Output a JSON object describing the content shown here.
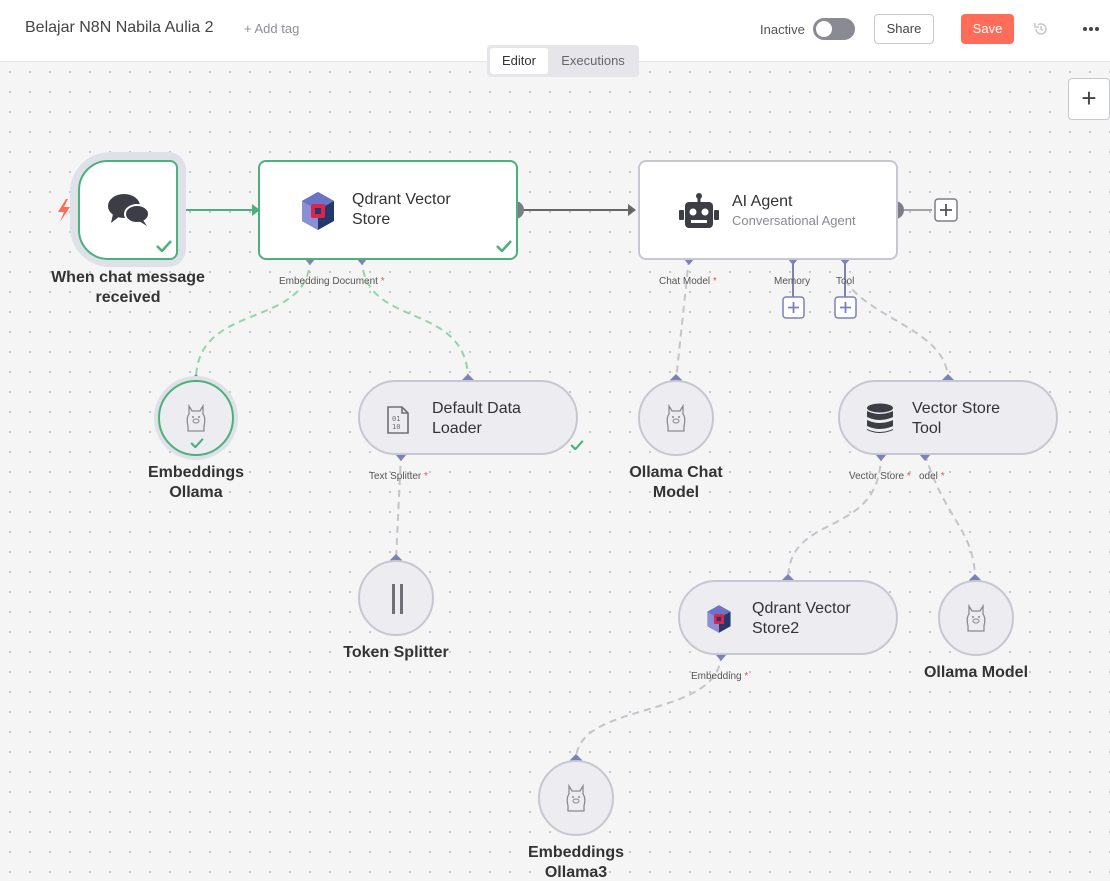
{
  "header": {
    "workflow_title": "Belajar N8N Nabila Aulia 2",
    "add_tag": "+ Add tag",
    "status_label": "Inactive",
    "share_label": "Share",
    "save_label": "Save"
  },
  "tabs": [
    {
      "label": "Editor",
      "active": true
    },
    {
      "label": "Executions",
      "active": false
    }
  ],
  "nodes": {
    "chat_trigger": {
      "label": "When chat message received",
      "status": "success"
    },
    "qdrant_store": {
      "title": "Qdrant Vector Store",
      "status": "success"
    },
    "ai_agent": {
      "title": "AI Agent",
      "subtitle": "Conversational Agent"
    },
    "embeddings_ollama": {
      "label": "Embeddings Ollama",
      "status": "success"
    },
    "default_data_loader": {
      "title": "Default Data Loader",
      "status": "success"
    },
    "ollama_chat_model": {
      "label": "Ollama Chat Model"
    },
    "vector_store_tool": {
      "title": "Vector Store Tool"
    },
    "token_splitter": {
      "label": "Token Splitter"
    },
    "qdrant_store2": {
      "title": "Qdrant Vector Store2"
    },
    "ollama_model": {
      "label": "Ollama Model"
    },
    "embeddings_ollama3": {
      "label": "Embeddings Ollama3"
    }
  },
  "ports": {
    "embedding_document": "Embedding Document",
    "chat_model": "Chat Model",
    "memory": "Memory",
    "tool": "Tool",
    "text_splitter": "Text Splitter",
    "vector_store": "Vector Store",
    "model": "odel",
    "embedding": "Embedding",
    "required_marker": "*"
  },
  "colors": {
    "accent": "#ff6d5a",
    "success": "#4cb07c",
    "connector": "#7b82b8",
    "node_border": "#c7c7d1"
  }
}
